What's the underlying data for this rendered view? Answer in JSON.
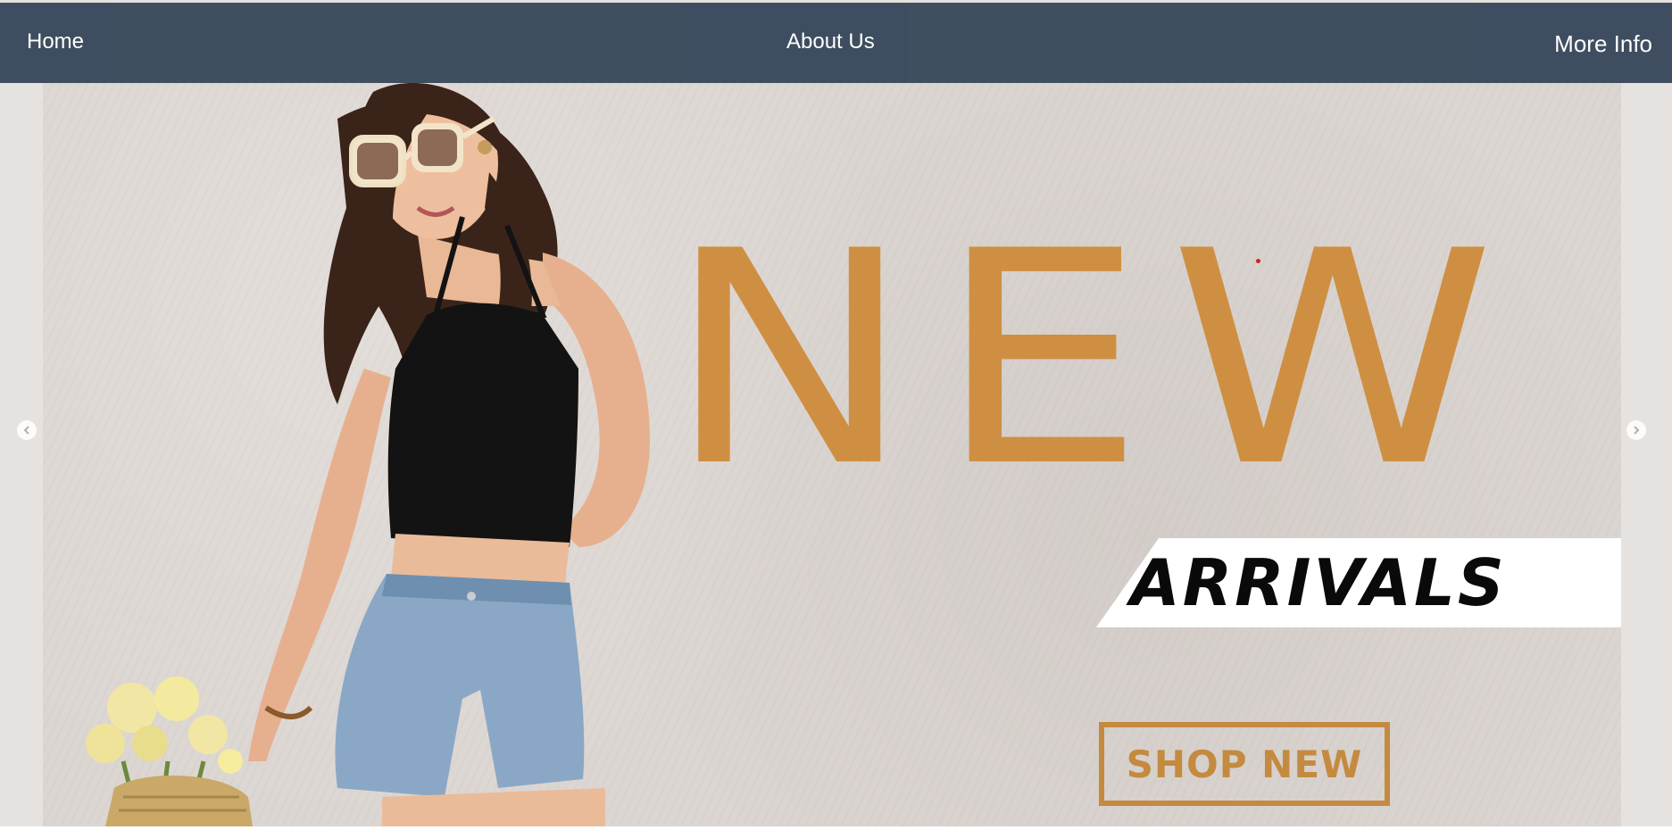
{
  "nav": {
    "home": "Home",
    "about": "About Us",
    "more": "More Info"
  },
  "banner": {
    "headline": "NEW",
    "subheadline": "ARRIVALS",
    "cta": "SHOP NEW"
  },
  "carousel": {
    "prev_icon": "chevron-left-icon",
    "next_icon": "chevron-right-icon"
  },
  "colors": {
    "navbar": "#394a5c",
    "headline": "#cf8f42",
    "cta": "#c48a3f",
    "top": "#111111",
    "denim": "#8aa8c6"
  }
}
